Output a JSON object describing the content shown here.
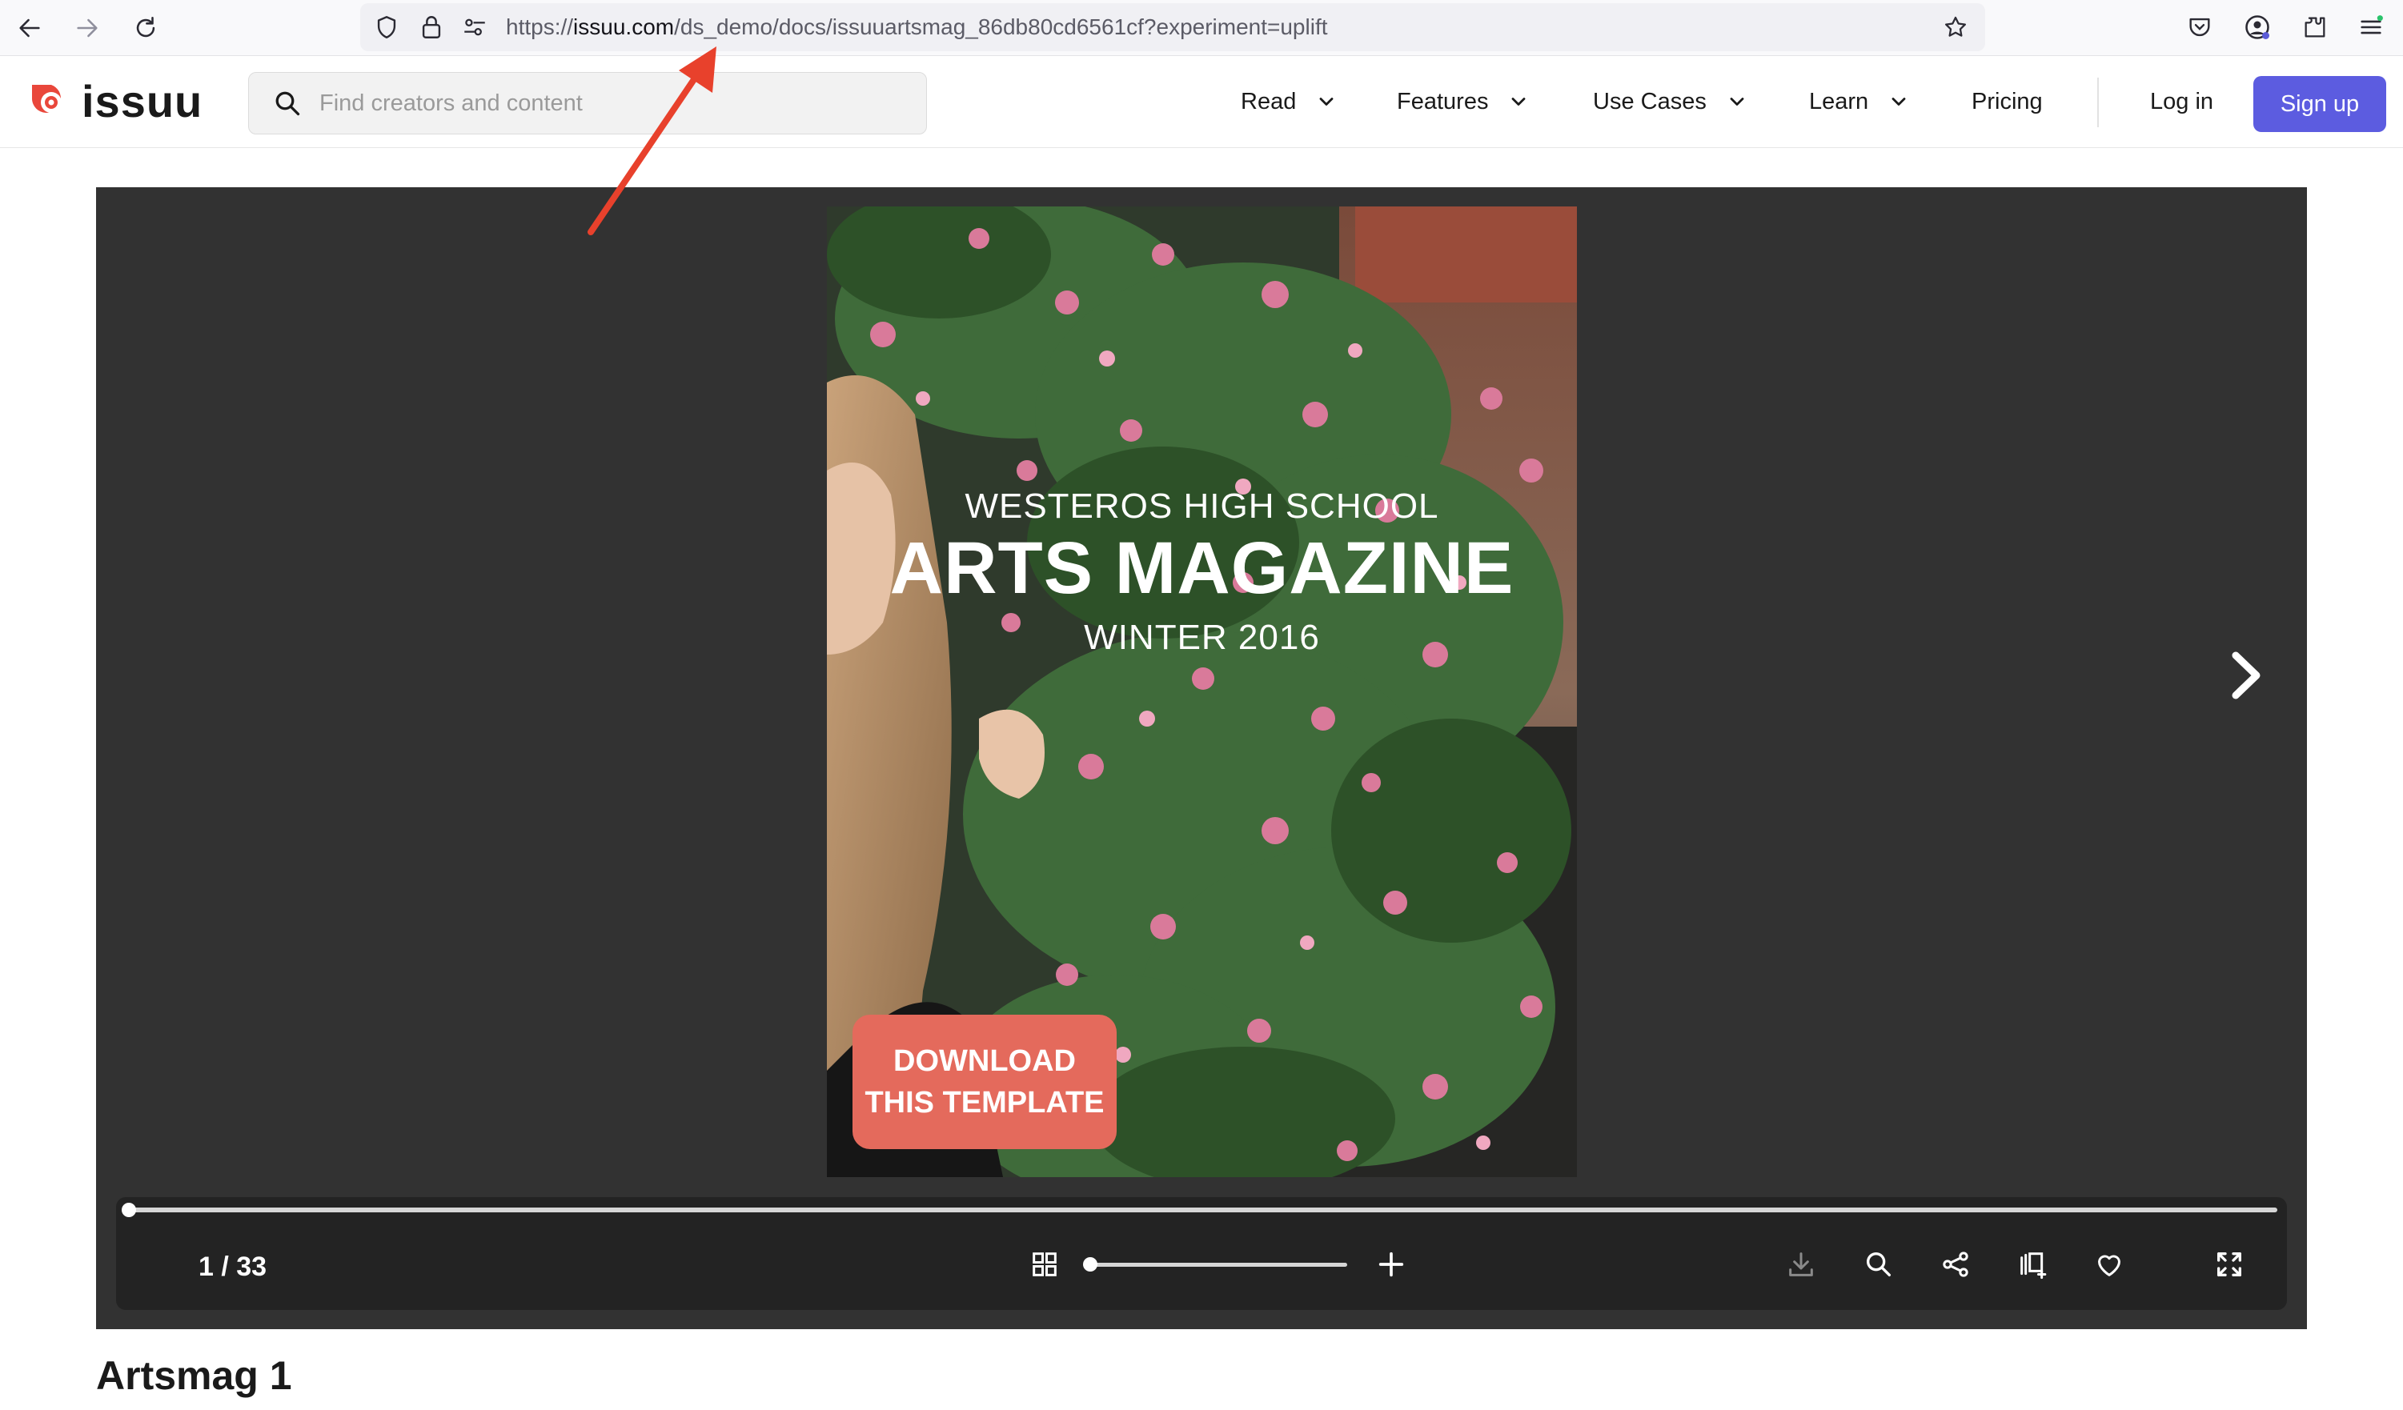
{
  "browser": {
    "url_scheme": "https://",
    "url_domain": "issuu.com",
    "url_path": "/ds_demo/docs/issuuartsmag_86db80cd6561cf?experiment=uplift",
    "icons": [
      "back-icon",
      "forward-icon",
      "reload-icon",
      "shield-icon",
      "lock-icon",
      "permissions-icon",
      "bookmark-star-icon",
      "pocket-icon",
      "account-icon",
      "extensions-icon",
      "menu-icon"
    ]
  },
  "header": {
    "logo_text": "issuu",
    "search_placeholder": "Find creators and content",
    "nav": {
      "read": "Read",
      "features": "Features",
      "use_cases": "Use Cases",
      "learn": "Learn",
      "pricing": "Pricing",
      "login": "Log in",
      "signup": "Sign up"
    }
  },
  "reader": {
    "cover": {
      "pre_title": "WESTEROS HIGH SCHOOL",
      "title": "ARTS MAGAZINE",
      "subtitle": "WINTER 2016",
      "button_line1": "DOWNLOAD",
      "button_line2": "THIS TEMPLATE"
    },
    "page_count": "1 / 33",
    "progress": 0.0,
    "zoom": 0.0
  },
  "document": {
    "title": "Artsmag 1"
  },
  "colors": {
    "brand": "#e9473b",
    "signup": "#5c5ce0",
    "reader_bg": "#323232",
    "controls_bg": "#232323",
    "cover_button": "#e46a5c",
    "annotation_arrow": "#e8412c"
  }
}
